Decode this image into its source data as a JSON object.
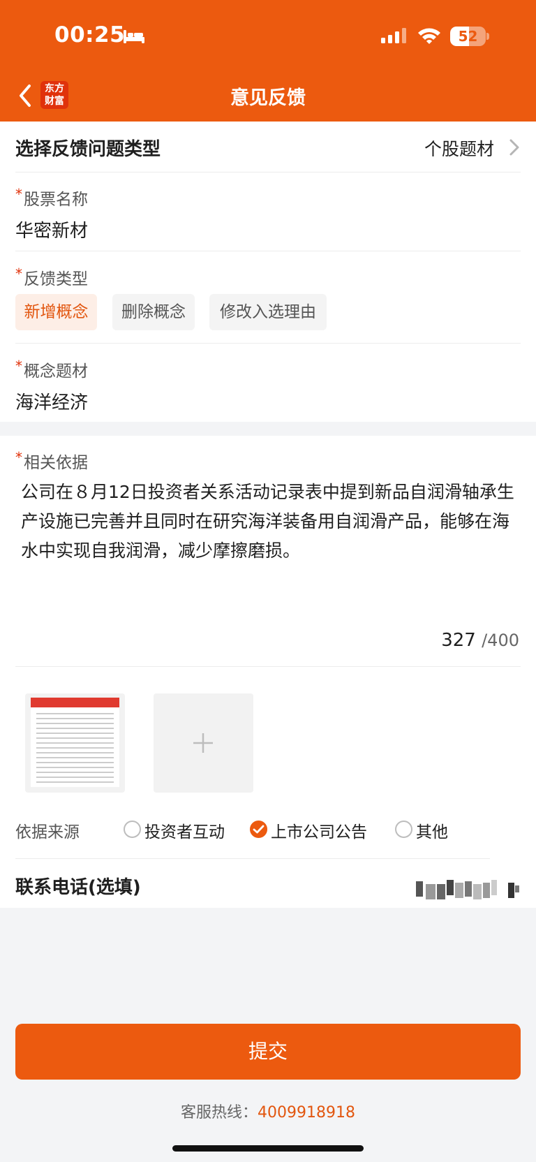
{
  "status_bar": {
    "time": "00:25",
    "battery": "52",
    "battery_level": 0.52,
    "icons": [
      "bed-icon",
      "signal-icon",
      "wifi-icon",
      "battery-icon"
    ]
  },
  "nav": {
    "back_icon": "chevron-left-icon",
    "logo_line1": "东方",
    "logo_line2": "财富",
    "title": "意见反馈"
  },
  "select_type": {
    "label": "选择反馈问题类型",
    "value": "个股题材"
  },
  "stock": {
    "required_mark": "*",
    "label": "股票名称",
    "value": "华密新材"
  },
  "feedback_type": {
    "required_mark": "*",
    "label": "反馈类型",
    "options": [
      "新增概念",
      "删除概念",
      "修改入选理由"
    ],
    "selected": "新增概念"
  },
  "concept": {
    "required_mark": "*",
    "label": "概念题材",
    "value": "海洋经济"
  },
  "basis": {
    "required_mark": "*",
    "label": "相关依据",
    "text": "公司在８月12日投资者关系活动记录表中提到新品自润滑轴承生产设施已完善并且同时在研究海洋装备用自润滑产品，能够在海水中实现自我润滑，减少摩擦磨损。",
    "count": "327",
    "max": "/400"
  },
  "attachments": {
    "add_icon": "plus-icon"
  },
  "source": {
    "label": "依据来源",
    "options": [
      "投资者互动",
      "上市公司公告",
      "其他"
    ],
    "selected": "上市公司公告"
  },
  "phone": {
    "label": "联系电话(选填)"
  },
  "footer": {
    "submit_label": "提交",
    "hotline_label": "客服热线：",
    "hotline_number": "4009918918"
  },
  "colors": {
    "accent": "#ec5a0f",
    "required": "#e0320b",
    "chip_active_bg": "#fdeee6"
  }
}
